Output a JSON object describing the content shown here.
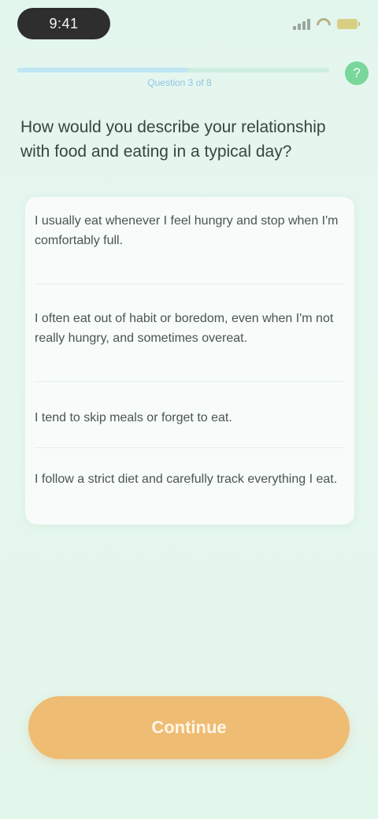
{
  "status_bar": {
    "time": "9:41",
    "signal_icon": "signal-icon",
    "wifi_icon": "wifi-icon",
    "battery_icon": "battery-icon"
  },
  "header": {
    "progress": 0.55,
    "step_label": "Question 3 of 8",
    "help_icon": "help-icon",
    "help_symbol": "?"
  },
  "question": {
    "text": "How would you describe your relationship with food and eating in a typical day?"
  },
  "options": [
    {
      "label": "I usually eat whenever I feel hungry and stop when I'm comfortably full."
    },
    {
      "label": "I often eat out of habit or boredom, even when I'm not really hungry, and sometimes overeat."
    },
    {
      "label": "I tend to skip meals or forget to eat."
    },
    {
      "label": "I follow a strict diet and carefully track everything I eat."
    }
  ],
  "footer": {
    "continue_label": "Continue"
  },
  "colors": {
    "background": "#e3f6ee",
    "accent_green": "#79d79b",
    "button_orange": "#efbc74",
    "step_blue": "#8fc6e4"
  }
}
